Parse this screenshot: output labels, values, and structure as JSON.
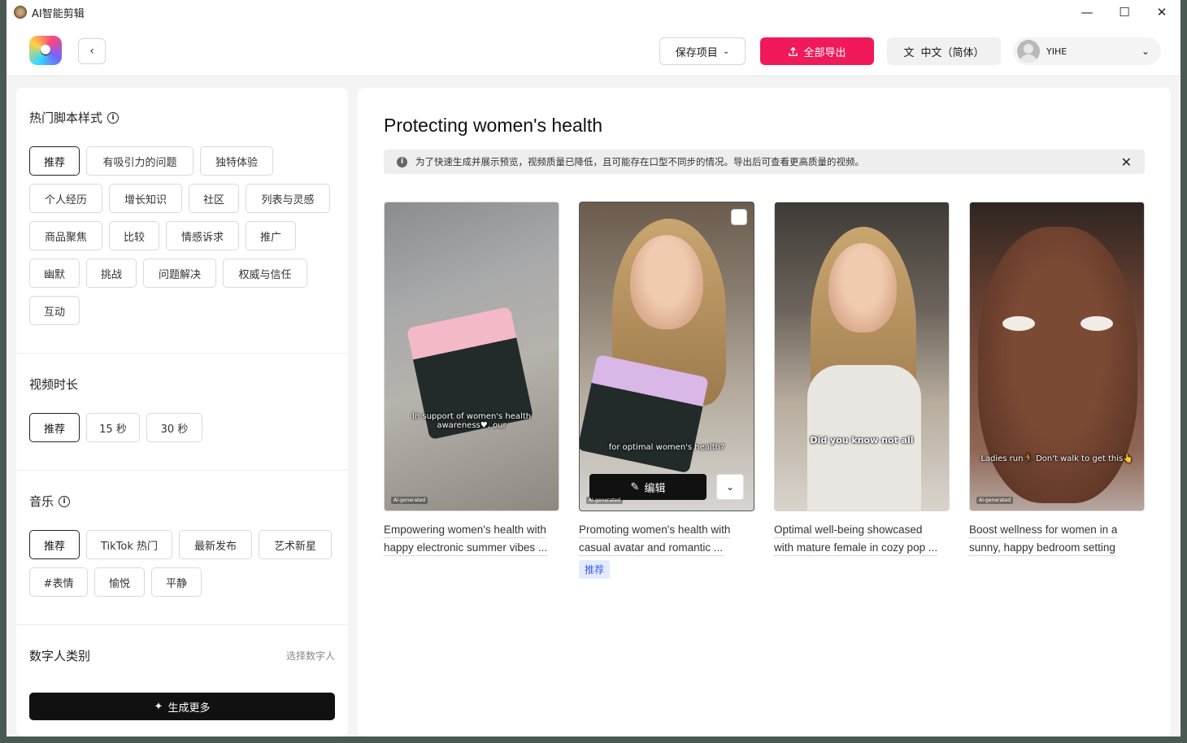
{
  "window": {
    "title": "AI智能剪辑",
    "controls": {
      "minimize": "—",
      "maximize": "☐",
      "close": "✕"
    }
  },
  "header": {
    "back_icon": "chevron-left-icon",
    "save_label": "保存项目",
    "export_label": "全部导出",
    "language_label": "中文（简体）",
    "user_name": "YIHE"
  },
  "sidebar": {
    "script_styles": {
      "title": "热门脚本样式",
      "chips": [
        "推荐",
        "有吸引力的问题",
        "独特体验",
        "个人经历",
        "增长知识",
        "社区",
        "列表与灵感",
        "商品聚焦",
        "比较",
        "情感诉求",
        "推广",
        "幽默",
        "挑战",
        "问题解决",
        "权威与信任",
        "互动"
      ],
      "selected": "推荐"
    },
    "duration": {
      "title": "视频时长",
      "chips": [
        "推荐",
        "15 秒",
        "30 秒"
      ],
      "selected": "推荐"
    },
    "music": {
      "title": "音乐",
      "chips": [
        "推荐",
        "TikTok 热门",
        "最新发布",
        "艺术新星",
        "#表情",
        "愉悦",
        "平静"
      ],
      "selected": "推荐"
    },
    "avatar_type": {
      "title": "数字人类别",
      "choose_label": "选择数字人"
    },
    "generate_label": "生成更多"
  },
  "main": {
    "title": "Protecting women's health",
    "notice": "为了快速生成并展示预览，视频质量已降低，且可能存在口型不同步的情况。导出后可查看更高质量的视频。",
    "cards": [
      {
        "caption": "In support of women's health awareness♥, our",
        "ai_tag": "AI-generated",
        "desc_line1": "Empowering women's health with",
        "desc_line2": "happy electronic summer vibes ..."
      },
      {
        "caption": "for optimal women's health?",
        "ai_tag": "AI-generated",
        "edit_label": "编辑",
        "desc_line1": "Promoting women's health with",
        "desc_line2": "casual avatar and romantic ...",
        "badge": "推荐"
      },
      {
        "caption": "Did you know not all",
        "desc_line1": "Optimal well-being showcased",
        "desc_line2": "with mature female in cozy pop ..."
      },
      {
        "caption": "Ladies run🏃 Don't walk to get this👆",
        "ai_tag": "AI-generated",
        "desc_line1": "Boost wellness for women in a",
        "desc_line2": "sunny, happy bedroom setting"
      }
    ]
  },
  "colors": {
    "accent": "#f0195a",
    "badge_bg": "#e3ebff",
    "badge_text": "#3d5ee0"
  }
}
